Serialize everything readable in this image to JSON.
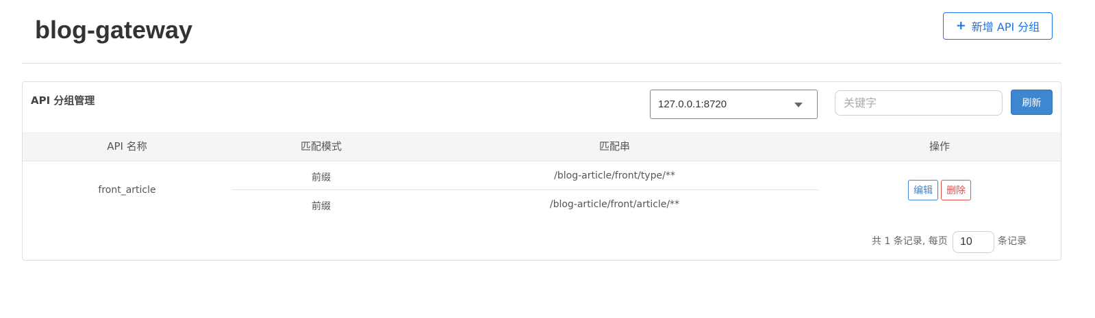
{
  "header": {
    "title": "blog-gateway",
    "add_button": {
      "icon": "plus-icon",
      "label": "新增 API 分组"
    }
  },
  "panel": {
    "title": "API 分组管理",
    "machine_select": {
      "value": "127.0.0.1:8720"
    },
    "search": {
      "placeholder": "关键字",
      "value": ""
    },
    "refresh_label": "刷新"
  },
  "table": {
    "columns": [
      "API 名称",
      "匹配模式",
      "匹配串",
      "操作"
    ],
    "rows": [
      {
        "api_name": "front_article",
        "predicates": [
          {
            "mode": "前缀",
            "pattern": "/blog-article/front/type/**"
          },
          {
            "mode": "前缀",
            "pattern": "/blog-article/front/article/**"
          }
        ],
        "actions": {
          "edit": "编辑",
          "delete": "删除"
        }
      }
    ]
  },
  "pagination": {
    "total_text": "共 1 条记录, 每页",
    "page_size": "10",
    "suffix": "条记录"
  },
  "colors": {
    "primary": "#3c87d0",
    "danger": "#d9534f",
    "header_bg": "#f5f5f6"
  }
}
